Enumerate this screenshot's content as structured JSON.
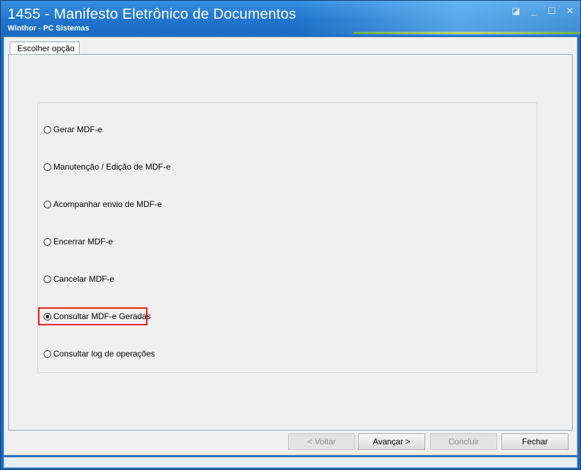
{
  "window": {
    "title": "1455 - Manifesto Eletrônico de Documentos",
    "subtitle": "Winthor - PC Sistemas",
    "icons": {
      "restore": "restore-icon",
      "minimize": "minimize-icon",
      "maximize": "maximize-icon",
      "close": "close-icon"
    }
  },
  "tab": {
    "label": "Escolher opção"
  },
  "options": [
    {
      "label": "Gerar MDF-e",
      "checked": false
    },
    {
      "label": "Manutenção / Edição de MDF-e",
      "checked": false
    },
    {
      "label": "Acompanhar envio de MDF-e",
      "checked": false
    },
    {
      "label": "Encerrar MDF-e",
      "checked": false
    },
    {
      "label": "Cancelar MDF-e",
      "checked": false
    },
    {
      "label": "Consultar MDF-e Geradas",
      "checked": true
    },
    {
      "label": "Consultar log de operações",
      "checked": false
    }
  ],
  "buttons": {
    "back": "< Voltar",
    "next": "Avançar >",
    "finish": "Concluir",
    "close": "Fechar"
  },
  "colors": {
    "highlight": "#e0201a",
    "titlebar": "#1f74cc"
  }
}
